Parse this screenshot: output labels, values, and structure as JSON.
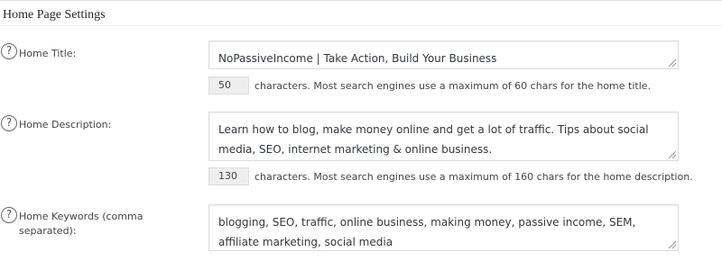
{
  "panel": {
    "title": "Home Page Settings"
  },
  "fields": [
    {
      "help_icon": "question-circle-icon",
      "help_glyph": "?",
      "label": "Home Title:",
      "value": "NoPassiveIncome | Take Action, Build Your Business",
      "char_count": "50",
      "note": "characters. Most search engines use a maximum of 60 chars for the home title."
    },
    {
      "help_icon": "question-circle-icon",
      "help_glyph": "?",
      "label": "Home Description:",
      "value": "Learn how to blog, make money online and get a lot of traffic. Tips about social media, SEO, internet marketing & online business.",
      "char_count": "130",
      "note": "characters. Most search engines use a maximum of 160 chars for the home description."
    },
    {
      "help_icon": "question-circle-icon",
      "help_glyph": "?",
      "label_line1": "Home Keywords (comma",
      "label_line2": "separated):",
      "value": "blogging, SEO, traffic, online business, making money, passive income, SEM, affiliate marketing, social media"
    }
  ]
}
